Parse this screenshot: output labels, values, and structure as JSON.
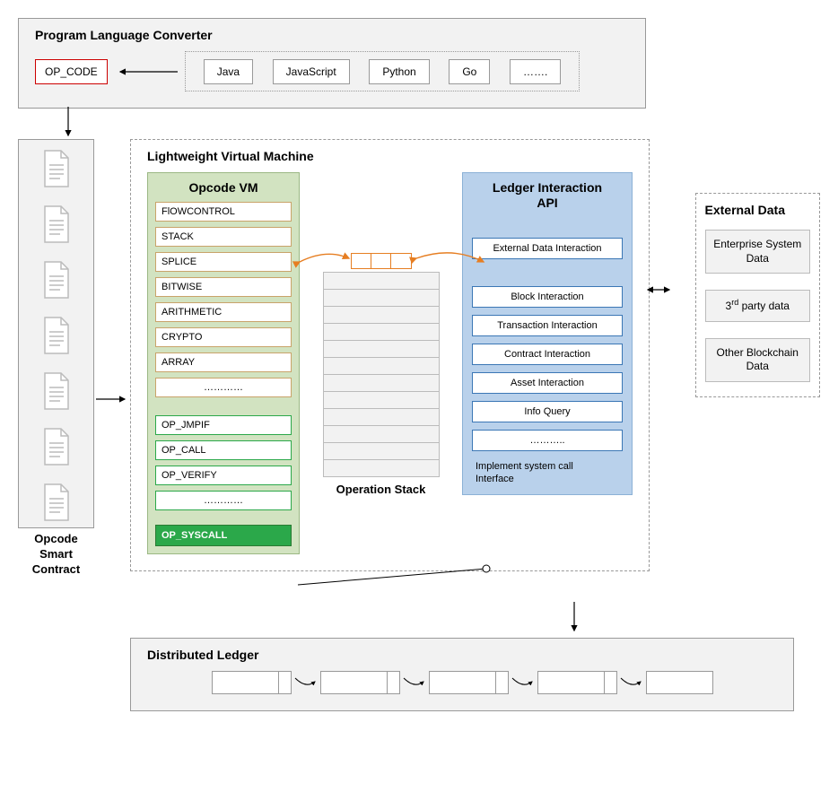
{
  "plc": {
    "title": "Program Language Converter",
    "opcode": "OP_CODE",
    "langs": [
      "Java",
      "JavaScript",
      "Python",
      "Go",
      "……."
    ]
  },
  "smartContract": {
    "label": "Opcode Smart Contract",
    "docCount": 7
  },
  "lvm": {
    "title": "Lightweight Virtual Machine",
    "opcodeVm": {
      "title": "Opcode VM",
      "categories": [
        "FlOWCONTROL",
        "STACK",
        "SPLICE",
        "BITWISE",
        "ARITHMETIC",
        "CRYPTO",
        "ARRAY",
        "…………"
      ],
      "ops": [
        "OP_JMPIF",
        "OP_CALL",
        "OP_VERIFY",
        "…………"
      ],
      "syscall": "OP_SYSCALL"
    },
    "stack": {
      "label": "Operation Stack",
      "rows": 12
    },
    "ledgerApi": {
      "title": "Ledger Interaction API",
      "external": "External Data Interaction",
      "items": [
        "Block Interaction",
        "Transaction Interaction",
        "Contract Interaction",
        "Asset Interaction",
        "Info Query",
        "……….."
      ],
      "syscallLabel": "Implement system call Interface"
    }
  },
  "external": {
    "title": "External Data",
    "items": [
      "Enterprise System Data",
      "3rd party data",
      "Other Blockchain Data"
    ]
  },
  "dl": {
    "title": "Distributed Ledger",
    "blockCount": 5
  }
}
